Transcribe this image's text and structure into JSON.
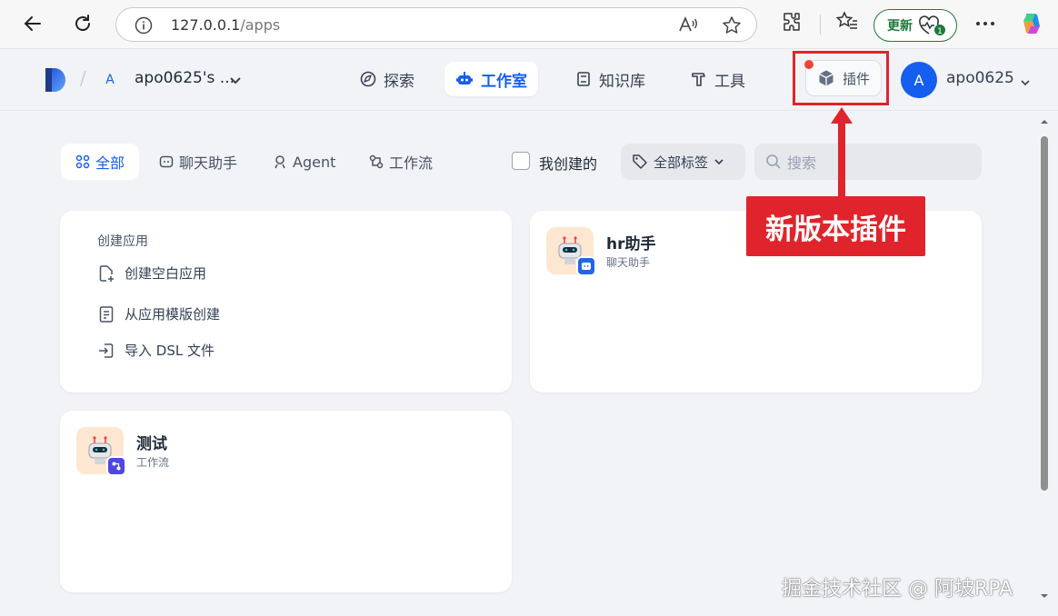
{
  "browser": {
    "url_host": "127.0.0.1",
    "url_path": "/apps",
    "update_label": "更新"
  },
  "header": {
    "workspace_initial": "A",
    "workspace_name": "apo0625's ...",
    "nav": [
      {
        "label": "探索",
        "icon": "compass-icon"
      },
      {
        "label": "工作室",
        "icon": "robot-icon"
      },
      {
        "label": "知识库",
        "icon": "book-icon"
      },
      {
        "label": "工具",
        "icon": "hammer-icon"
      }
    ],
    "plugin_label": "插件",
    "user_initial": "A",
    "user_name": "apo0625"
  },
  "filters": {
    "tabs": [
      {
        "label": "全部",
        "icon": "grid-icon"
      },
      {
        "label": "聊天助手",
        "icon": "chat-icon"
      },
      {
        "label": "Agent",
        "icon": "agent-icon"
      },
      {
        "label": "工作流",
        "icon": "workflow-icon"
      }
    ],
    "mine_label": "我创建的",
    "tag_label": "全部标签",
    "search_placeholder": "搜索"
  },
  "create_card": {
    "title": "创建应用",
    "items": [
      "创建空白应用",
      "从应用模版创建",
      "导入 DSL 文件"
    ]
  },
  "apps": [
    {
      "name": "hr助手",
      "type": "聊天助手"
    },
    {
      "name": "测试",
      "type": "工作流"
    }
  ],
  "annotation": {
    "label": "新版本插件",
    "color": "#e0242c"
  },
  "watermark": "掘金技术社区 @ 阿坡RPA",
  "colors": {
    "accent": "#155eef",
    "annotation": "#e0242c",
    "update_green": "#1c7a3a"
  }
}
